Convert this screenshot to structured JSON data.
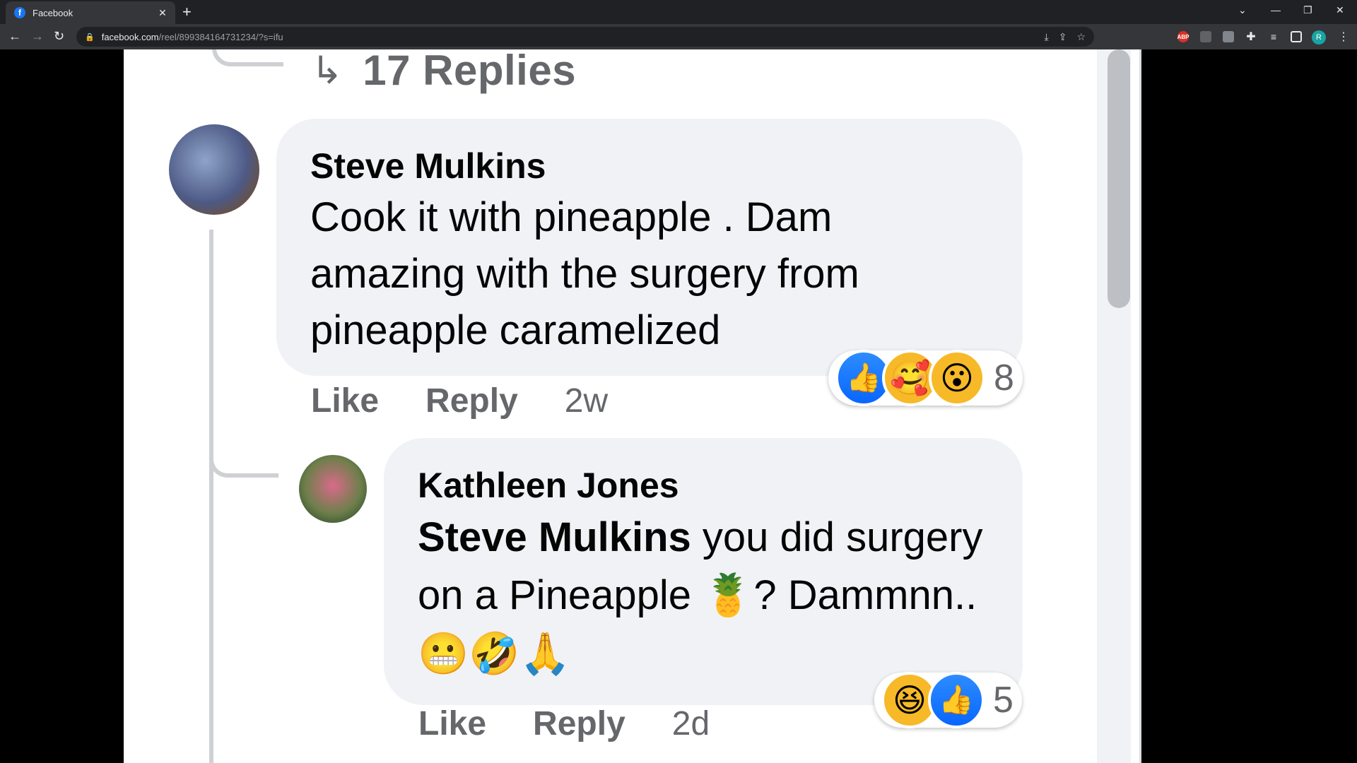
{
  "browser": {
    "tab_title": "Facebook",
    "url_domain": "facebook.com",
    "url_path": "/reel/899384164731234/?s=ifu",
    "profile_initial": "R",
    "ext_abp": "ABP"
  },
  "replies_link": {
    "label": "17 Replies"
  },
  "comments": [
    {
      "author": "Steve Mulkins",
      "text_lines": [
        "Cook it with pineapple . Dam",
        "amazing with the surgery from",
        "pineapple caramelized"
      ],
      "actions": {
        "like": "Like",
        "reply": "Reply",
        "time": "2w"
      },
      "reactions": {
        "icons": [
          "like-icon",
          "care-icon",
          "wow-icon"
        ],
        "count": "8"
      }
    },
    {
      "author": "Kathleen Jones",
      "mention": "Steve Mulkins",
      "text_line1_rest": " you did surgery",
      "text_line2": "on a Pineapple 🍍? Dammnn..",
      "text_line3": "😬🤣🙏",
      "actions": {
        "like": "Like",
        "reply": "Reply",
        "time": "2d"
      },
      "reactions": {
        "icons": [
          "haha-icon",
          "like-icon"
        ],
        "count": "5"
      }
    }
  ]
}
